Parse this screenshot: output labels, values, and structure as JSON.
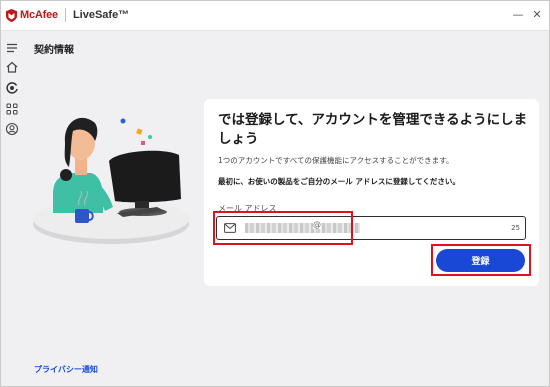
{
  "titlebar": {
    "brand": "McAfee",
    "product": "LiveSafe™",
    "minimize": "—",
    "close": "✕"
  },
  "sidebar": {
    "icons": [
      "menu-icon",
      "home-icon",
      "security-icon",
      "apps-grid-icon",
      "account-icon"
    ]
  },
  "page": {
    "title": "契約情報"
  },
  "card": {
    "headline": "では登録して、アカウントを管理できるようにしましょう",
    "subtext": "1つのアカウントですべての保護機能にアクセスすることができます。",
    "instruction": "最初に、お使いの製品をご自分のメール アドレスに登録してください。",
    "email_label": "メール アドレス",
    "email_at": "@",
    "char_count": "25",
    "register_label": "登録"
  },
  "footer": {
    "privacy_link": "プライバシー通知"
  },
  "colors": {
    "brand_red": "#c01818",
    "accent_blue": "#1a48d6",
    "highlight_red": "#e01020"
  }
}
